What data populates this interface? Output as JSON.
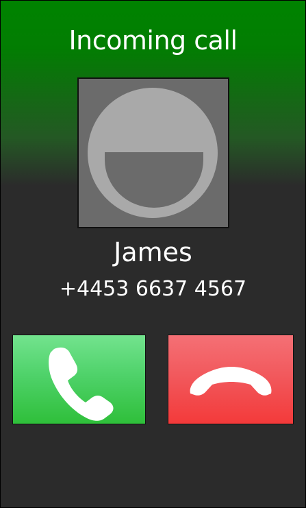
{
  "screen": {
    "title": "Incoming call",
    "background_top_color": "#008300",
    "background_bottom_color": "#2b2b2b"
  },
  "caller": {
    "avatar_icon": "smiley-avatar-icon",
    "name": "James",
    "number": "+4453 6637 4567"
  },
  "actions": {
    "answer": {
      "icon": "phone-answer-icon",
      "color": "#3cc84e"
    },
    "decline": {
      "icon": "phone-hangup-icon",
      "color": "#f24a4d"
    }
  }
}
